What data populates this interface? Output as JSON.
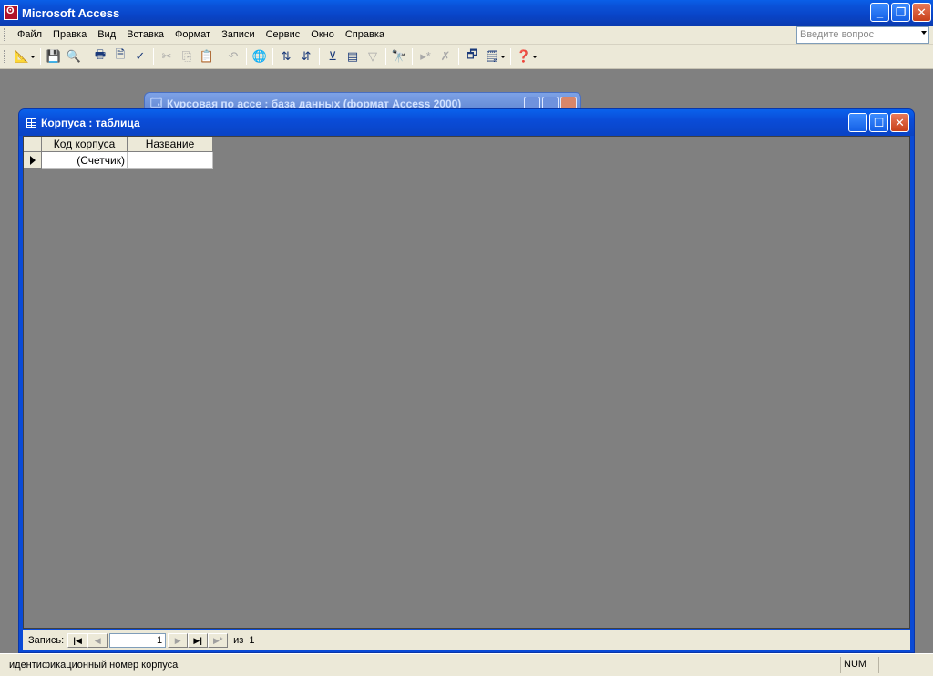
{
  "app": {
    "title": "Microsoft Access"
  },
  "menu": {
    "items": [
      "Файл",
      "Правка",
      "Вид",
      "Вставка",
      "Формат",
      "Записи",
      "Сервис",
      "Окно",
      "Справка"
    ],
    "ask_placeholder": "Введите вопрос"
  },
  "db_window": {
    "title": "Курсовая по ассе : база данных (формат Access 2000)"
  },
  "table_window": {
    "title": "Корпуса : таблица",
    "columns": [
      "Код корпуса",
      "Название"
    ],
    "rows": [
      {
        "code": "(Счетчик)",
        "name": ""
      }
    ]
  },
  "navigation": {
    "label": "Запись:",
    "current": "1",
    "of_label": "из",
    "total": "1"
  },
  "status": {
    "text": "идентификационный номер корпуса",
    "num": "NUM"
  },
  "icons": {
    "toolbar": [
      "view-icon",
      "save-icon",
      "search-file-icon",
      "print-icon",
      "print-preview-icon",
      "spelling-icon",
      "cut-icon",
      "copy-icon",
      "paste-icon",
      "undo-icon",
      "hyperlink-icon",
      "sort-asc-icon",
      "sort-desc-icon",
      "filter-selection-icon",
      "filter-form-icon",
      "apply-filter-icon",
      "find-icon",
      "new-record-icon",
      "delete-record-icon",
      "database-window-icon",
      "new-object-icon",
      "help-icon"
    ]
  }
}
